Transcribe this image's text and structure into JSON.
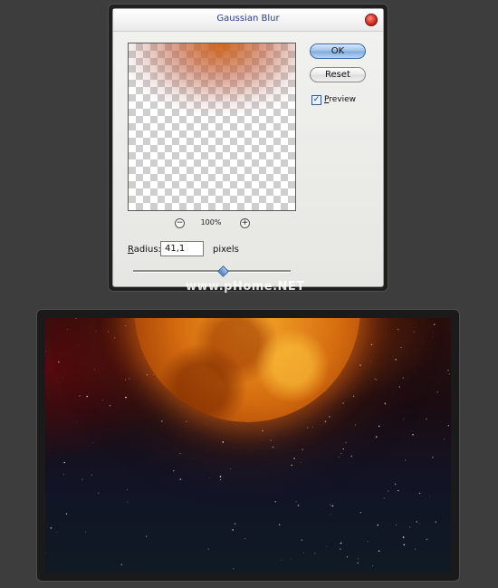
{
  "dialog": {
    "title": "Gaussian Blur",
    "ok_label": "OK",
    "reset_label": "Reset",
    "preview_label_first": "P",
    "preview_label_rest": "review",
    "preview_checked": true,
    "check_glyph": "✓",
    "zoom_level": "100%",
    "zoom_out_glyph": "−",
    "zoom_in_glyph": "+",
    "radius_label_first": "R",
    "radius_label_rest": "adius:",
    "radius_value": "41,1",
    "radius_unit": "pixels",
    "slider_fraction": 0.57,
    "accent_color": "#3b6aa8"
  },
  "watermark": "www.pHome.NET",
  "canvas": {
    "subject": "orange planet over starfield",
    "colors": {
      "planet": "#d66d10",
      "space_top": "#2a0e0b",
      "space_bottom": "#0f1a24"
    }
  }
}
